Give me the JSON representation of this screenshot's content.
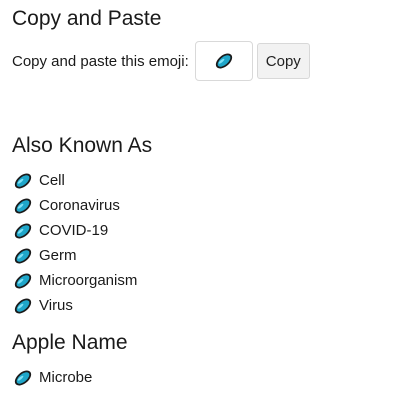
{
  "copy_section": {
    "title": "Copy and Paste",
    "label": "Copy and paste this emoji:",
    "button_label": "Copy",
    "emoji_icon": "microbe-icon"
  },
  "aka_section": {
    "title": "Also Known As",
    "items": [
      {
        "label": "Cell"
      },
      {
        "label": "Coronavirus"
      },
      {
        "label": "COVID-19"
      },
      {
        "label": "Germ"
      },
      {
        "label": "Microorganism"
      },
      {
        "label": "Virus"
      }
    ]
  },
  "apple_section": {
    "title": "Apple Name",
    "items": [
      {
        "label": "Microbe"
      }
    ]
  },
  "colors": {
    "microbe_fill": "#1fa6c9",
    "microbe_outline": "#1a1a1a"
  }
}
